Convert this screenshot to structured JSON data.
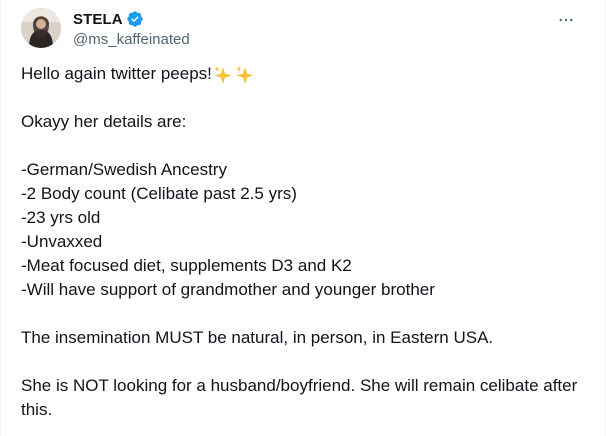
{
  "author": {
    "display_name": "STELA",
    "handle": "@ms_kaffeinated",
    "verified": true,
    "verified_color": "#1d9bf0"
  },
  "icons": {
    "verified": "verified-badge-icon",
    "more": "more-options-icon",
    "sparkles": "sparkles-emoji"
  },
  "tweet": {
    "lines": {
      "greeting": "Hello again twitter peeps!",
      "intro": "Okayy her details are:",
      "detail_1": "-German/Swedish Ancestry",
      "detail_2": "-2 Body count (Celibate past 2.5 yrs)",
      "detail_3": "-23 yrs old",
      "detail_4": "-Unvaxxed",
      "detail_5": "-Meat focused diet, supplements D3 and K2",
      "detail_6": "-Will have support of grandmother and younger brother",
      "insemination": "The insemination MUST be natural, in person, in Eastern USA.",
      "closing": "She is NOT looking for a husband/boyfriend. She will remain celibate after this."
    }
  },
  "colors": {
    "text_primary": "#0f1419",
    "text_secondary": "#536471",
    "sparkle": "#f7c13a"
  }
}
